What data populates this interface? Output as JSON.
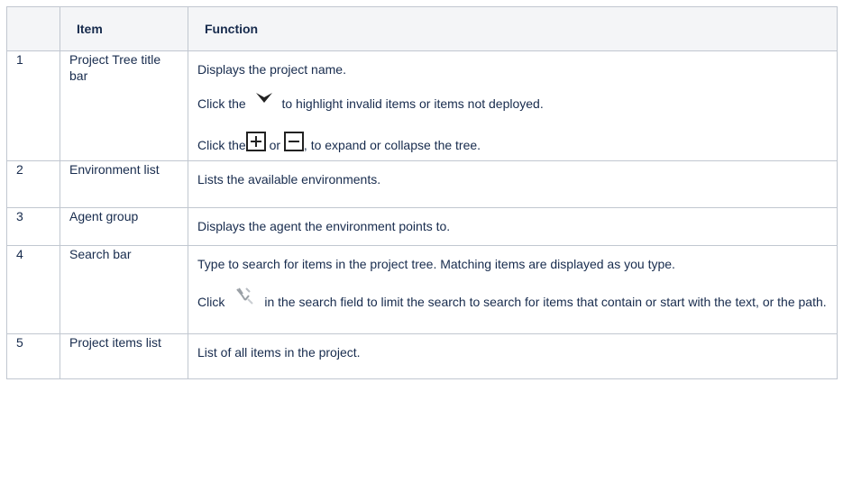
{
  "table": {
    "headers": [
      "",
      "Item",
      "Function"
    ],
    "rows": [
      {
        "num": "1",
        "item": "Project Tree title bar",
        "func": {
          "p1": "Displays the project name.",
          "p2_prefix": "Click the",
          "p2_icon": "filter-icon",
          "p2_suffix": "to highlight invalid items or items not deployed.",
          "p3_prefix": "Click the",
          "p3_icon1": "expand-plus-icon",
          "p3_mid": "or",
          "p3_icon2": "collapse-minus-icon",
          "p3_suffix": ", to expand or collapse the tree."
        }
      },
      {
        "num": "2",
        "item": "Environment list",
        "func": {
          "p1": "Lists the available environments."
        }
      },
      {
        "num": "3",
        "item": "Agent group",
        "func": {
          "p1": "Displays the agent the environment points to."
        }
      },
      {
        "num": "4",
        "item": "Search bar",
        "func": {
          "p1": "Type to search for items in the project tree. Matching items are displayed as you type.",
          "p2_prefix": "Click",
          "p2_icon": "search-options-icon",
          "p2_suffix": "in the search field to limit the search to search for items that contain or start with the text, or the path."
        }
      },
      {
        "num": "5",
        "item": "Project items list",
        "func": {
          "p1": "List of all items in the project."
        }
      }
    ]
  }
}
